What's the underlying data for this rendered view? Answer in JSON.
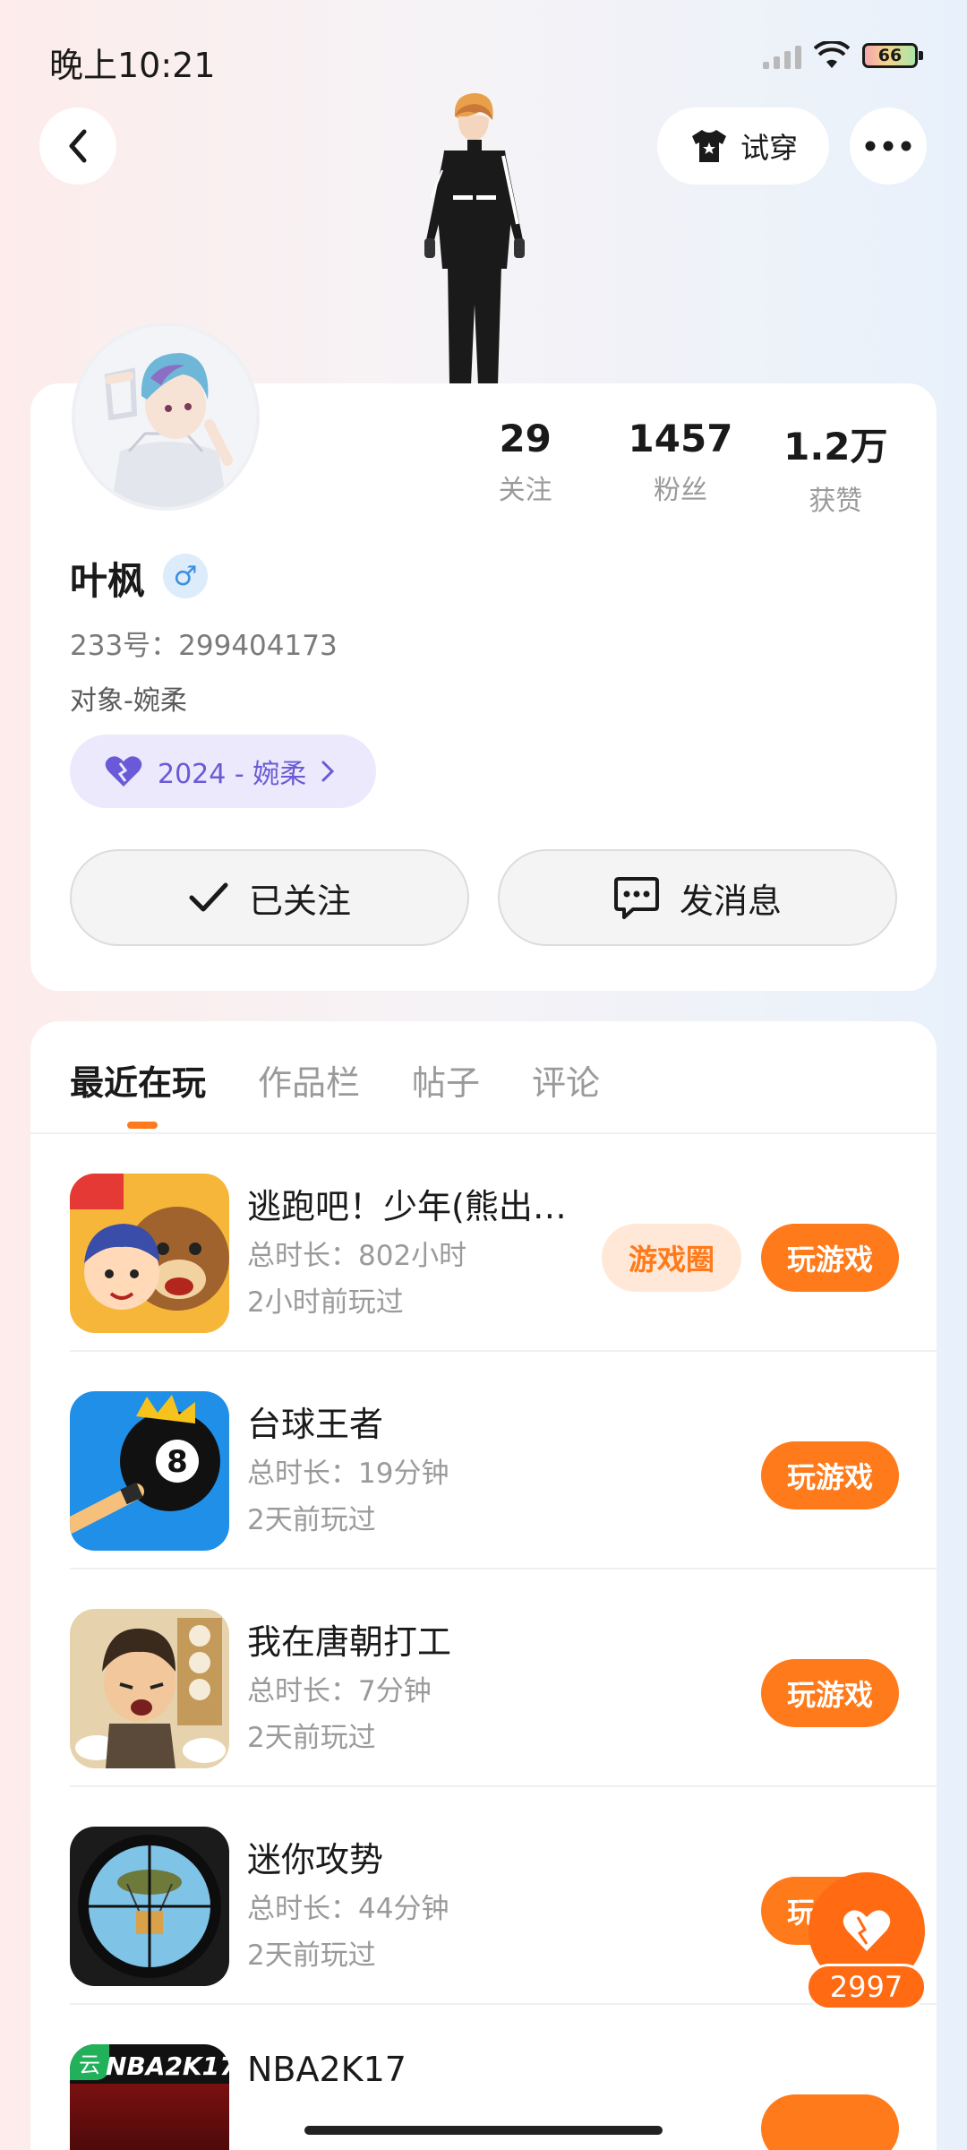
{
  "status_bar": {
    "time": "晚上10:21",
    "battery": "66"
  },
  "header": {
    "try_on_label": "试穿"
  },
  "profile": {
    "stats": [
      {
        "value": "29",
        "label": "关注"
      },
      {
        "value": "1457",
        "label": "粉丝"
      },
      {
        "value": "1.2万",
        "label": "获赞"
      }
    ],
    "name": "叶枫",
    "gender_symbol": "♂",
    "uid": "233号：299404173",
    "bio": "对象-婉柔",
    "cp_badge": "2024 - 婉柔",
    "follow_label": "已关注",
    "message_label": "发消息"
  },
  "tabs": [
    "最近在玩",
    "作品栏",
    "帖子",
    "评论"
  ],
  "games": [
    {
      "name": "逃跑吧！少年(熊出…",
      "total": "总时长：802小时",
      "last": "2小时前玩过",
      "circle_label": "游戏圈",
      "play_label": "玩游戏"
    },
    {
      "name": "台球王者",
      "total": "总时长：19分钟",
      "last": "2天前玩过",
      "play_label": "玩游戏"
    },
    {
      "name": "我在唐朝打工",
      "total": "总时长：7分钟",
      "last": "2天前玩过",
      "play_label": "玩游戏"
    },
    {
      "name": "迷你攻势",
      "total": "总时长：44分钟",
      "last": "2天前玩过",
      "play_label": "玩游戏"
    },
    {
      "name": "NBA2K17",
      "icon_tag": "云",
      "icon_text": "NBA2K17"
    }
  ],
  "like": {
    "count": "2997"
  },
  "colors": {
    "accent": "#ff7a1a",
    "accent_light": "#ffe8d8",
    "cp_purple": "#6a5ad7"
  }
}
